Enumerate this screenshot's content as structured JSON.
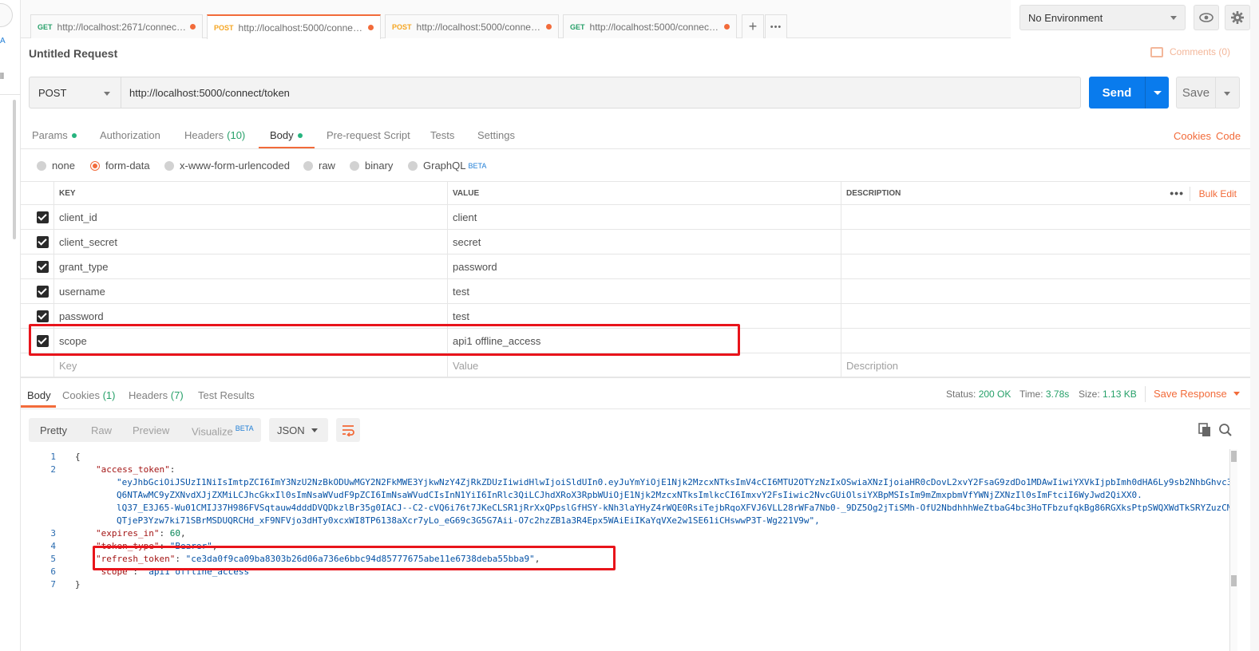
{
  "left": {
    "t1": "A",
    "t2": "ll"
  },
  "tabs": [
    {
      "method": "GET",
      "url": "http://localhost:2671/connect/t..."
    },
    {
      "method": "POST",
      "url": "http://localhost:5000/connect/..."
    },
    {
      "method": "POST",
      "url": "http://localhost:5000/connect/..."
    },
    {
      "method": "GET",
      "url": "http://localhost:5000/connect/u..."
    }
  ],
  "tabbar": {
    "add": "+",
    "more": "•••"
  },
  "environment": {
    "selected": "No Environment"
  },
  "request": {
    "title": "Untitled Request",
    "comments": "Comments (0)",
    "method": "POST",
    "url": "http://localhost:5000/connect/token",
    "send": "Send",
    "save": "Save"
  },
  "reqtabs": {
    "params": "Params",
    "authorization": "Authorization",
    "headers": "Headers",
    "headers_count": "(10)",
    "body": "Body",
    "prerequest": "Pre-request Script",
    "tests": "Tests",
    "settings": "Settings",
    "cookies": "Cookies",
    "code": "Code"
  },
  "bodytypes": {
    "none": "none",
    "formdata": "form-data",
    "urlencoded": "x-www-form-urlencoded",
    "raw": "raw",
    "binary": "binary",
    "graphql": "GraphQL",
    "beta": "BETA"
  },
  "table": {
    "headers": {
      "key": "KEY",
      "value": "VALUE",
      "description": "DESCRIPTION",
      "more": "•••",
      "bulk": "Bulk Edit"
    },
    "rows": [
      {
        "key": "client_id",
        "value": "client"
      },
      {
        "key": "client_secret",
        "value": "secret"
      },
      {
        "key": "grant_type",
        "value": "password"
      },
      {
        "key": "username",
        "value": "test"
      },
      {
        "key": "password",
        "value": "test"
      },
      {
        "key": "scope",
        "value": "api1 offline_access"
      }
    ],
    "placeholder": {
      "key": "Key",
      "value": "Value",
      "description": "Description"
    }
  },
  "response": {
    "tabs": {
      "body": "Body",
      "cookies": "Cookies",
      "cookies_count": "(1)",
      "headers": "Headers",
      "headers_count": "(7)",
      "tests": "Test Results"
    },
    "status_label": "Status:",
    "status": "200 OK",
    "time_label": "Time:",
    "time": "3.78s",
    "size_label": "Size:",
    "size": "1.13 KB",
    "save": "Save Response",
    "views": {
      "pretty": "Pretty",
      "raw": "Raw",
      "preview": "Preview",
      "visualize": "Visualize",
      "beta": "BETA"
    },
    "format": "JSON",
    "code": {
      "ln": [
        "1",
        "2",
        "3",
        "4",
        "5",
        "6",
        "7"
      ],
      "open": "{",
      "k_access": "\"access_token\"",
      "colon": ": ",
      "access_1": "\"eyJhbGciOiJSUzI1NiIsImtpZCI6ImY3NzU2NzBkODUwMGY2N2FkMWE3YjkwNzY4ZjRkZDUzIiwidHlwIjoiSldUIn0.eyJuYmYiOjE1Njk2MzcxNTksImV4cCI6MTU2OTYzNzIxOSwiaXNzIjoiaHR0cDovL2xvY2FsaG9zdDo1MDAwIiwiYXVkIjpbImh0dHA6Ly9sb2NhbGhvc3",
      "access_2": "Q6NTAwMC9yZXNvdXJjZXMiLCJhcGkxIl0sImNsaWVudF9pZCI6ImNsaWVudCIsInN1YiI6InRlc3QiLCJhdXRoX3RpbWUiOjE1Njk2MzcxNTksImlkcCI6ImxvY2FsIiwic2NvcGUiOlsiYXBpMSIsIm9mZmxpbmVfYWNjZXNzIl0sImFtciI6WyJwd2QiXX0.",
      "access_3": "lQ37_E3J65-Wu01CMIJ37H986FVSqtauw4dddDVQDkzlBr35g0IACJ--C2-cVQ6i76t7JKeCLSR1jRrXxQPpslGfHSY-kNh3laYHyZ4rWQE0RsiTejbRqoXFVJ6VLL28rWFa7Nb0-_9DZ5Og2jTiSMh-OfU2NbdhhhWeZtbaG4bc3HoTFbzufqkBg86RGXksPtpSWQXWdTkSRYZuzCM",
      "access_4": "QTjeP3Yzw7ki71SBrMSDUQRCHd_xF9NFVjo3dHTy0xcxWI8TP6138aXcr7yLo_eG69c3G5G7Aii-O7c2hzZB1a3R4Epx5WAiEiIKaYqVXe2w1SE61iCHswwP3T-Wg221V9w\",",
      "k_expires": "\"expires_in\"",
      "v_expires": "60",
      "comma": ",",
      "k_tokentype": "\"token_type\"",
      "v_tokentype": "\"Bearer\"",
      "k_refresh": "\"refresh_token\"",
      "v_refresh": "\"ce3da0f9ca09ba8303b26d06a736e6bbc94d85777675abe11e6738deba55bba9\"",
      "k_scope": "\"scope\"",
      "v_scope": "\"api1 offline_access\"",
      "close": "}"
    }
  },
  "colors": {
    "accent": "#f26b3a",
    "send": "#097bed",
    "get": "#26a069",
    "post": "#f5a623",
    "highlight": "#e8141b"
  }
}
